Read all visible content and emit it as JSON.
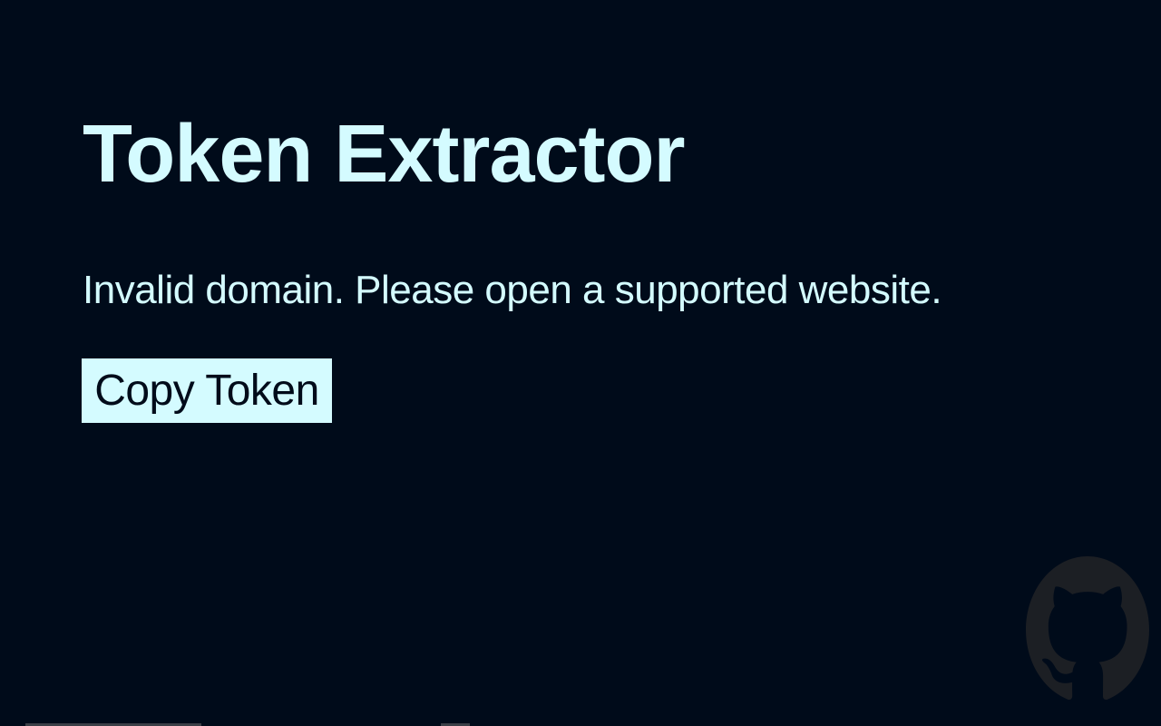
{
  "header": {
    "title": "Token Extractor"
  },
  "status": {
    "message": "Invalid domain. Please open a supported website."
  },
  "actions": {
    "copy_label": "Copy Token"
  },
  "footer": {
    "github_icon": "github-icon"
  },
  "colors": {
    "background": "#000b1a",
    "text": "#d4fbff",
    "button_bg": "#d4fbff",
    "button_text": "#000b1a",
    "icon": "#1c1f24"
  }
}
